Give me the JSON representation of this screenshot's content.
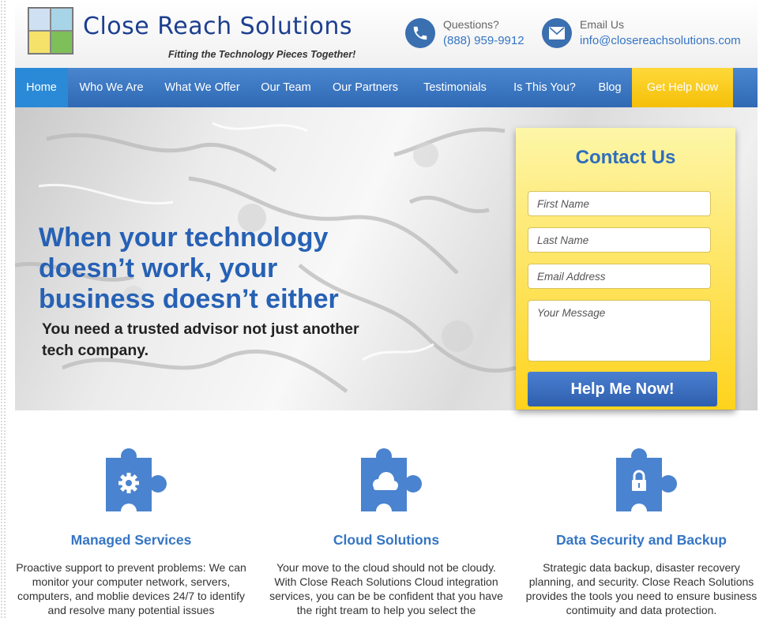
{
  "brand": {
    "name": "Close Reach Solutions",
    "tagline": "Fitting the Technology Pieces Together!",
    "colors": {
      "primary_blue": "#2e6ebc",
      "nav_blue": "#3a78c4",
      "cta_yellow": "#f8cc1a"
    }
  },
  "header": {
    "phone": {
      "label": "Questions?",
      "value": "(888) 959-9912",
      "icon": "phone-icon"
    },
    "email": {
      "label": "Email Us",
      "value": "info@closereachsolutions.com",
      "icon": "envelope-icon"
    }
  },
  "nav": {
    "items": [
      {
        "label": "Home",
        "active": true
      },
      {
        "label": "Who We Are"
      },
      {
        "label": "What We Offer"
      },
      {
        "label": "Our Team"
      },
      {
        "label": "Our Partners"
      },
      {
        "label": "Testimonials"
      },
      {
        "label": "Is This You?"
      },
      {
        "label": "Blog"
      },
      {
        "label": "Get Help Now",
        "highlight": true
      }
    ]
  },
  "hero": {
    "headline": "When your technology doesn’t work, your business doesn’t either",
    "subheadline": "You need a trusted advisor not just another tech company."
  },
  "contact_form": {
    "title": "Contact Us",
    "first_name_placeholder": "First Name",
    "last_name_placeholder": "Last Name",
    "email_placeholder": "Email Address",
    "message_placeholder": "Your Message",
    "submit_label": "Help Me Now!"
  },
  "services": [
    {
      "icon": "gear-icon",
      "title": "Managed Services",
      "text": "Proactive support to prevent problems: We can monitor your computer network, servers, computers, and moblie devices 24/7 to identify and resolve many potential issues"
    },
    {
      "icon": "cloud-icon",
      "title": "Cloud Solutions",
      "text": "Your move to the cloud should not be cloudy. With Close Reach Solutions Cloud integration services, you can be be confident that you have the right tream to help you select the"
    },
    {
      "icon": "lock-icon",
      "title": "Data Security and Backup",
      "text": "Strategic data backup, disaster recovery planning, and security. Close Reach Solutions provides the tools you need to ensure business contimuity and data protection."
    }
  ]
}
